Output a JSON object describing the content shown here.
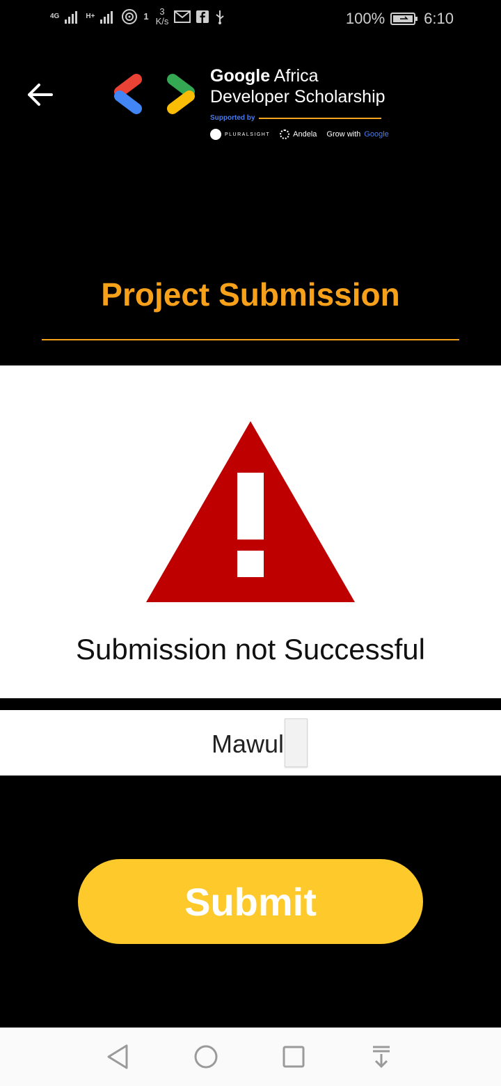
{
  "status_bar": {
    "network_1": "4G",
    "network_2": "H+",
    "hotspot_count": "1",
    "speed_value": "3",
    "speed_unit": "K/s",
    "battery": "100%",
    "time": "6:10"
  },
  "header": {
    "brand_bold": "Google",
    "brand_rest": " Africa",
    "brand_line2": "Developer Scholarship",
    "supported_by": "Supported by",
    "partners": [
      "PLURALSIGHT",
      "Andela",
      "Grow with",
      "Google"
    ]
  },
  "page": {
    "title": "Project Submission"
  },
  "result": {
    "message": "Submission not Successful"
  },
  "form": {
    "name_value": "Mawuli"
  },
  "actions": {
    "submit_label": "Submit"
  },
  "colors": {
    "accent": "#f7a11a",
    "submit": "#fdc92b",
    "warning": "#bf0000",
    "logo_red": "#ea4335",
    "logo_blue": "#4285f4",
    "logo_green": "#34a853",
    "logo_yellow": "#fbbc05"
  }
}
